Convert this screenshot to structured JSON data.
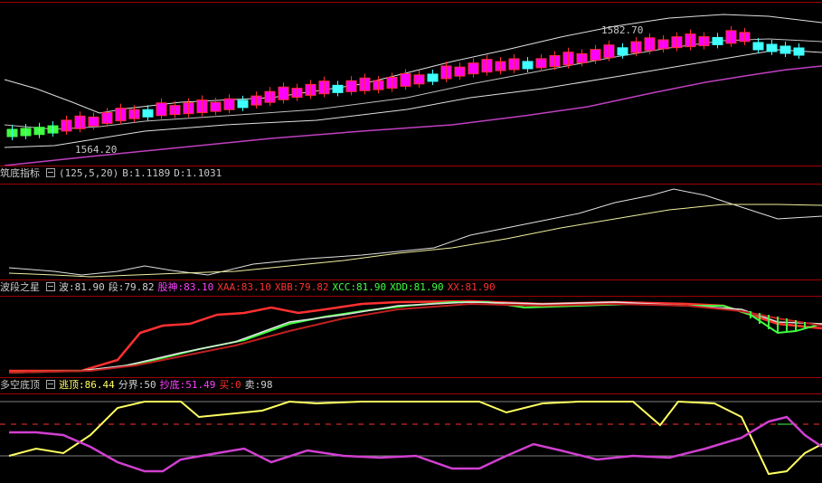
{
  "main": {
    "high_label": "1582.70",
    "low_label": "1564.20"
  },
  "ind1": {
    "title": "筑底指标",
    "params": "(125,5,20)",
    "b": "B:1.1189",
    "d": "D:1.1031"
  },
  "ind2": {
    "title": "波段之星",
    "items": [
      {
        "text": "波:81.90",
        "color": "#d0d0d0"
      },
      {
        "text": "段:79.82",
        "color": "#d0d0d0"
      },
      {
        "text": "股神:83.10",
        "color": "#ff40ff"
      },
      {
        "text": "XAA:83.10",
        "color": "#ff3030"
      },
      {
        "text": "XBB:79.82",
        "color": "#ff3030"
      },
      {
        "text": "XCC:81.90",
        "color": "#40ff40"
      },
      {
        "text": "XDD:81.90",
        "color": "#40ff40"
      },
      {
        "text": "XX:81.90",
        "color": "#ff3030"
      }
    ]
  },
  "ind3": {
    "title": "多空底顶",
    "items": [
      {
        "text": "逃顶:86.44",
        "color": "#ffff60"
      },
      {
        "text": "分界:50",
        "color": "#d0d0d0"
      },
      {
        "text": "抄底:51.49",
        "color": "#ff40ff"
      },
      {
        "text": "买:0",
        "color": "#ff3030"
      },
      {
        "text": "卖:98",
        "color": "#d0d0d0"
      }
    ]
  },
  "colors": {
    "bg": "#000000",
    "separator": "#a00000",
    "up_candle": "#ff00ff",
    "down_candle": "#40ffff",
    "red": "#ff3030",
    "green": "#40ff40",
    "yellow": "#ffff60",
    "magenta": "#d040d0"
  }
}
